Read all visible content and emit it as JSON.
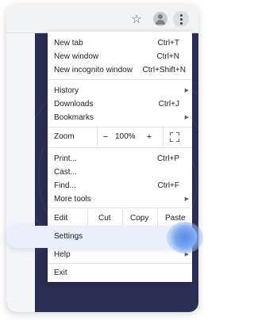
{
  "toolbar": {
    "icons": [
      "star-icon",
      "profile-avatar-icon",
      "kebab-menu-icon"
    ]
  },
  "menu": {
    "new_tab": {
      "label": "New tab",
      "shortcut": "Ctrl+T"
    },
    "new_window": {
      "label": "New window",
      "shortcut": "Ctrl+N"
    },
    "new_incognito": {
      "label": "New incognito window",
      "shortcut": "Ctrl+Shift+N"
    },
    "history": {
      "label": "History",
      "arrow": "▶"
    },
    "downloads": {
      "label": "Downloads",
      "shortcut": "Ctrl+J"
    },
    "bookmarks": {
      "label": "Bookmarks",
      "arrow": "▶"
    },
    "zoom": {
      "label": "Zoom",
      "minus": "−",
      "value": "100%",
      "plus": "+"
    },
    "print": {
      "label": "Print...",
      "shortcut": "Ctrl+P"
    },
    "cast": {
      "label": "Cast..."
    },
    "find": {
      "label": "Find...",
      "shortcut": "Ctrl+F"
    },
    "more_tools": {
      "label": "More tools",
      "arrow": "▶"
    },
    "edit": {
      "label": "Edit",
      "cut": "Cut",
      "copy": "Copy",
      "paste": "Paste"
    },
    "settings": {
      "label": "Settings"
    },
    "help": {
      "label": "Help",
      "arrow": "▶"
    },
    "exit": {
      "label": "Exit"
    }
  },
  "colors": {
    "accent_highlight": "#eaf0fb",
    "cursor_glow": "#5b8de8",
    "page_background": "#2c2f55"
  }
}
